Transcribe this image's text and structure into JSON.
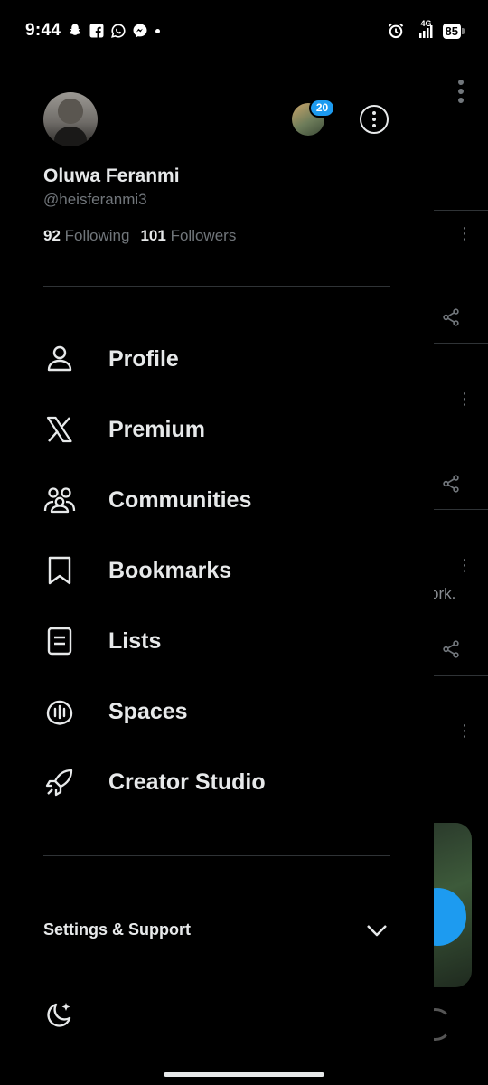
{
  "status_bar": {
    "time": "9:44",
    "battery": "85",
    "network": "4G",
    "icons": [
      "snapchat-icon",
      "facebook-icon",
      "whatsapp-icon",
      "messenger-icon",
      "alarm-icon",
      "signal-icon",
      "battery-icon"
    ]
  },
  "profile": {
    "display_name": "Oluwa Feranmi",
    "handle": "@heisferanmi3",
    "following_count": "92",
    "following_label": "Following",
    "followers_count": "101",
    "followers_label": "Followers",
    "notification_badge": "20"
  },
  "menu": {
    "items": [
      {
        "label": "Profile",
        "icon": "person-icon"
      },
      {
        "label": "Premium",
        "icon": "x-logo-icon"
      },
      {
        "label": "Communities",
        "icon": "communities-icon"
      },
      {
        "label": "Bookmarks",
        "icon": "bookmark-icon"
      },
      {
        "label": "Lists",
        "icon": "list-icon"
      },
      {
        "label": "Spaces",
        "icon": "spaces-icon"
      },
      {
        "label": "Creator Studio",
        "icon": "rocket-icon"
      }
    ]
  },
  "settings": {
    "label": "Settings & Support"
  },
  "feed_peek": {
    "text_fragment": "ork."
  },
  "colors": {
    "background": "#000000",
    "text_primary": "#e7e9ea",
    "text_secondary": "#71767b",
    "accent": "#1d9bf0",
    "divider": "#2f3336"
  }
}
